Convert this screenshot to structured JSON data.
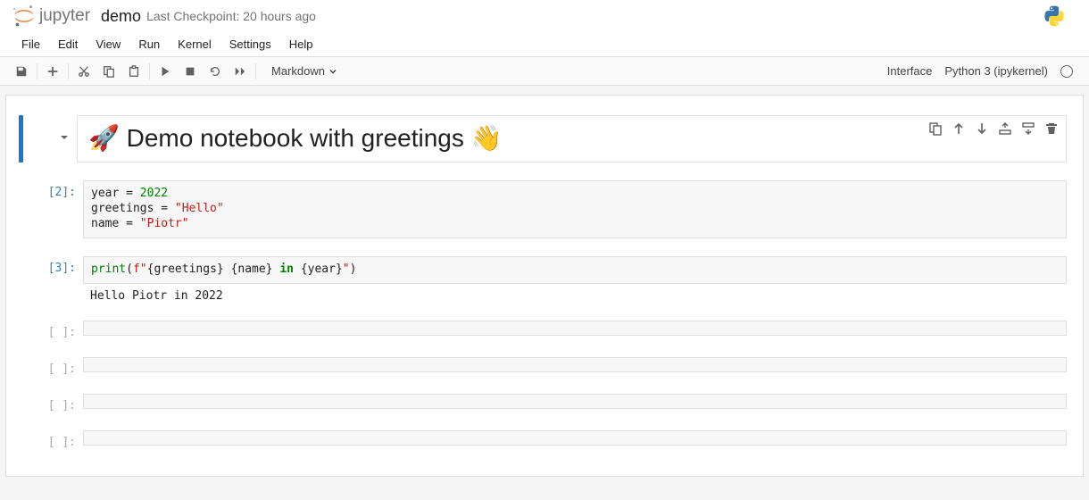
{
  "header": {
    "brand": "jupyter",
    "title": "demo",
    "checkpoint": "Last Checkpoint: 20 hours ago"
  },
  "menu": {
    "file": "File",
    "edit": "Edit",
    "view": "View",
    "run": "Run",
    "kernel": "Kernel",
    "settings": "Settings",
    "help": "Help"
  },
  "toolbar": {
    "cell_type": "Markdown",
    "interface": "Interface",
    "kernel": "Python 3 (ipykernel)"
  },
  "cells": {
    "c0": {
      "heading": "🚀 Demo notebook with greetings 👋"
    },
    "c1": {
      "prompt": "[2]:",
      "code_html": "year = <span class='tk-num'>2022</span>\ngreetings = <span class='tk-str'>\"Hello\"</span>\nname = <span class='tk-str'>\"Piotr\"</span>"
    },
    "c2": {
      "prompt": "[3]:",
      "code_html": "<span class='tk-builtin'>print</span>(<span class='tk-fstr'>f\"</span>{greetings} {name} <span class='tk-kw'>in</span> {year}<span class='tk-fstr'>\"</span>)",
      "output": "Hello Piotr in 2022"
    },
    "c3": {
      "prompt": "[ ]:"
    },
    "c4": {
      "prompt": "[ ]:"
    },
    "c5": {
      "prompt": "[ ]:"
    },
    "c6": {
      "prompt": "[ ]:"
    }
  }
}
